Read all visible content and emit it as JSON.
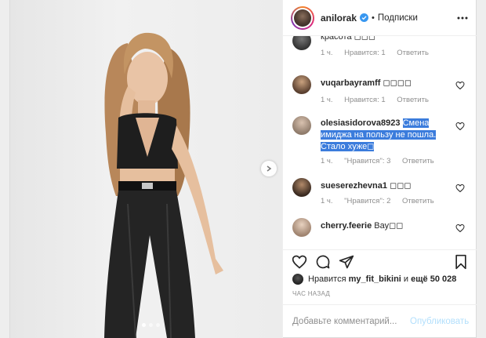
{
  "header": {
    "username": "anilorak",
    "separator": "•",
    "follow_label": "Подписки"
  },
  "comments": [
    {
      "text": "красота ◻◻◻",
      "time": "1 ч.",
      "likes": "Нравится: 1",
      "reply": "Ответить"
    },
    {
      "username": "vuqarbayramff",
      "text": "◻◻◻◻",
      "time": "1 ч.",
      "likes": "Нравится: 1",
      "reply": "Ответить"
    },
    {
      "username": "olesiasidorova8923",
      "text": "Смена имиджа на пользу не пошла. Стало хуже◻",
      "time": "1 ч.",
      "likes": "\"Нравится\": 3",
      "reply": "Ответить"
    },
    {
      "username": "sueserezhevna1",
      "text": "◻◻◻",
      "time": "1 ч.",
      "likes": "\"Нравится\": 2",
      "reply": "Ответить"
    },
    {
      "username": "cherry.feerie",
      "text": "Вау◻◻"
    }
  ],
  "likes_line": {
    "prefix": "Нравится",
    "user": "my_fit_bikini",
    "and": "и",
    "others": "ещё 50 028"
  },
  "timestamp": "ЧАС НАЗАД",
  "add_comment": {
    "placeholder": "Добавьте комментарий...",
    "publish_label": "Опубликовать"
  },
  "colors": {
    "highlight": "#3b7cdc",
    "verified": "#3897f0",
    "publish_disabled": "#b2dffc"
  },
  "carousel": {
    "slides": 3,
    "active": 1
  }
}
